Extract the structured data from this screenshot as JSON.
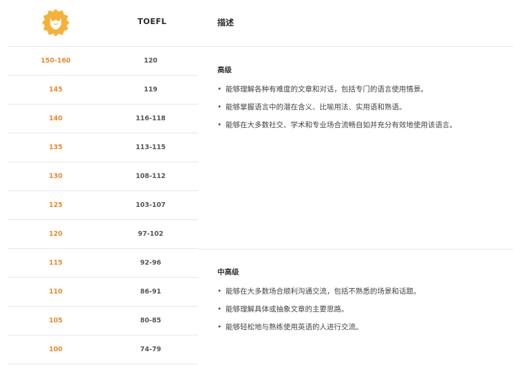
{
  "header": {
    "logo_icon": "fox-head-badge-icon",
    "col_toefl": "TOEFL",
    "col_desc": "描述"
  },
  "colors": {
    "score": "#e8892a",
    "logo": "#f5b237"
  },
  "rows": [
    {
      "score": "150-160",
      "toefl": "120"
    },
    {
      "score": "145",
      "toefl": "119"
    },
    {
      "score": "140",
      "toefl": "116-118"
    },
    {
      "score": "135",
      "toefl": "113-115"
    },
    {
      "score": "130",
      "toefl": "108-112"
    },
    {
      "score": "125",
      "toefl": "103-107"
    },
    {
      "score": "120",
      "toefl": "97-102"
    },
    {
      "score": "115",
      "toefl": "92-96"
    },
    {
      "score": "110",
      "toefl": "86-91"
    },
    {
      "score": "105",
      "toefl": "80-85"
    },
    {
      "score": "100",
      "toefl": "74-79"
    }
  ],
  "sections": [
    {
      "level": "高级",
      "items": [
        "能够理解各种有难度的文章和对话，包括专门的语言使用情景。",
        "能够掌握语言中的潜在含义、比喻用法、实用语和熟语。",
        "能够在大多数社交、学术和专业场合流畅自如并充分有效地使用该语言。"
      ]
    },
    {
      "level": "中高级",
      "items": [
        "能够在大多数场合顺利沟通交流，包括不熟悉的场景和话题。",
        "能够理解具体或抽象文章的主要思路。",
        "能够轻松地与熟练使用英语的人进行交流。"
      ]
    }
  ]
}
